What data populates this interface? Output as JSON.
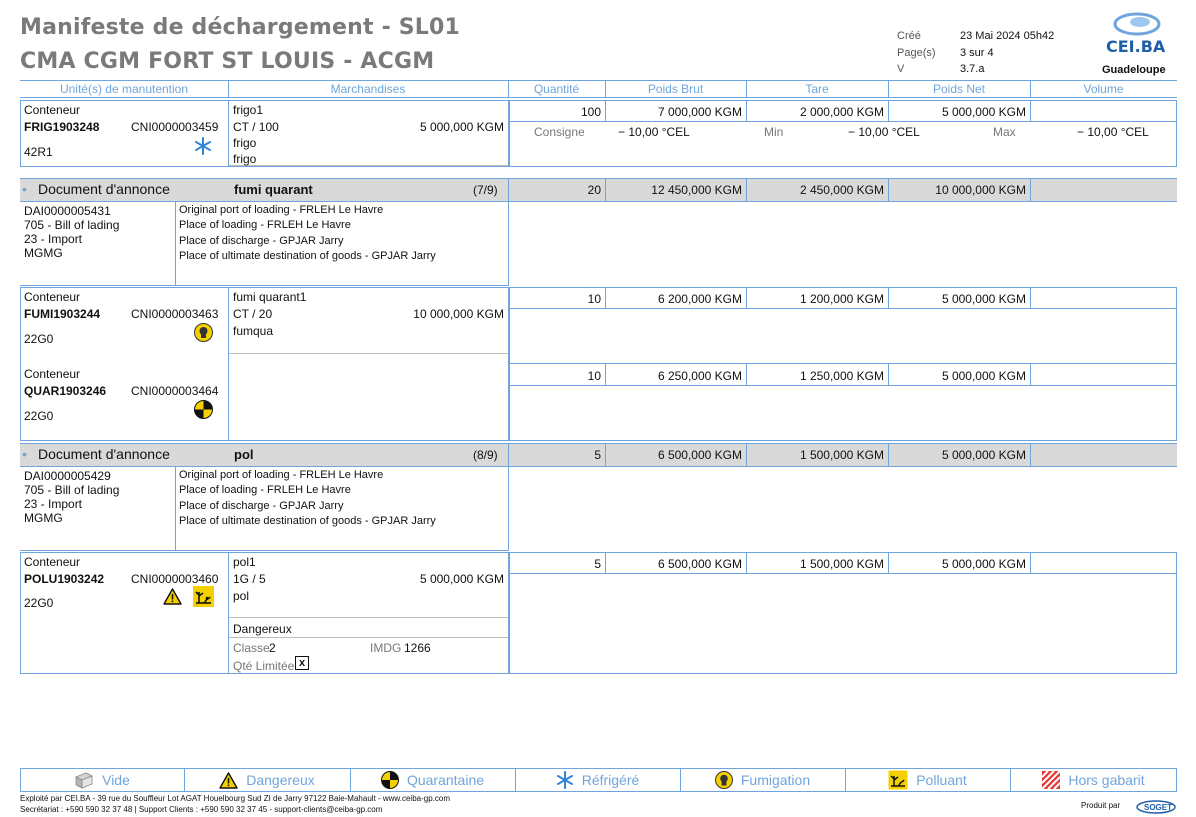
{
  "header": {
    "title": "Manifeste de déchargement - SL01",
    "vessel": "CMA CGM FORT ST LOUIS - ACGM",
    "created_label": "Créé",
    "created_value": "23 Mai 2024 05h42",
    "pages_label": "Page(s)",
    "pages_value": "3 sur 4",
    "version_label": "V",
    "version_value": "3.7.a",
    "logo_text": "CEI.BA",
    "region": "Guadeloupe"
  },
  "columns": {
    "units": "Unité(s) de manutention",
    "goods": "Marchandises",
    "qty": "Quantité",
    "gross": "Poids Brut",
    "tare": "Tare",
    "net": "Poids Net",
    "volume": "Volume"
  },
  "frig": {
    "label": "Conteneur",
    "number": "FRIG1903248",
    "cni": "CNI0000003459",
    "type": "42R1",
    "goods_title": "frigo1",
    "goods_pack": "CT /  100",
    "goods_weight": "5 000,000 KGM",
    "goods_line1": "frigo",
    "goods_line2": "frigo",
    "qty": "100",
    "gross": "7 000,000 KGM",
    "tare": "2 000,000 KGM",
    "net": "5 000,000 KGM",
    "consigne_label": "Consigne",
    "consigne_value": "−  10,00 °CEL",
    "min_label": "Min",
    "min_value": "−  10,00 °CEL",
    "max_label": "Max",
    "max_value": "−  10,00 °CEL"
  },
  "doc1": {
    "label": "Document d'annonce",
    "name": "fumi quarant",
    "count": "(7/9)",
    "qty": "20",
    "gross": "12 450,000 KGM",
    "tare": "2 450,000 KGM",
    "net": "10 000,000 KGM",
    "dai": "DAI0000005431",
    "bl": "705 - Bill of lading",
    "regime": "23 - Import",
    "code": "MGMG",
    "port_loading": "Original port of loading - FRLEH Le Havre",
    "place_loading": "Place of loading - FRLEH Le Havre",
    "place_discharge": "Place of discharge - GPJAR Jarry",
    "place_dest": "Place of ultimate destination of goods - GPJAR Jarry"
  },
  "fumi": {
    "label": "Conteneur",
    "number": "FUMI1903244",
    "cni": "CNI0000003463",
    "type": "22G0",
    "goods_title": "fumi quarant1",
    "goods_pack": "CT /  20",
    "goods_weight": "10 000,000 KGM",
    "goods_line1": "fumqua",
    "qty": "10",
    "gross": "6 200,000 KGM",
    "tare": "1 200,000 KGM",
    "net": "5 000,000 KGM"
  },
  "quar": {
    "label": "Conteneur",
    "number": "QUAR1903246",
    "cni": "CNI0000003464",
    "type": "22G0",
    "qty": "10",
    "gross": "6 250,000 KGM",
    "tare": "1 250,000 KGM",
    "net": "5 000,000 KGM"
  },
  "doc2": {
    "label": "Document d'annonce",
    "name": "pol",
    "count": "(8/9)",
    "qty": "5",
    "gross": "6 500,000 KGM",
    "tare": "1 500,000 KGM",
    "net": "5 000,000 KGM",
    "dai": "DAI0000005429",
    "bl": "705 - Bill of lading",
    "regime": "23 - Import",
    "code": "MGMG",
    "port_loading": "Original port of loading - FRLEH Le Havre",
    "place_loading": "Place of loading - FRLEH Le Havre",
    "place_discharge": "Place of discharge - GPJAR Jarry",
    "place_dest": "Place of ultimate destination of goods - GPJAR Jarry"
  },
  "polu": {
    "label": "Conteneur",
    "number": "POLU1903242",
    "cni": "CNI0000003460",
    "type": "22G0",
    "goods_title": "pol1",
    "goods_pack": "1G /  5",
    "goods_weight": "5 000,000 KGM",
    "goods_line1": "pol",
    "danger_title": "Dangereux",
    "classe_label": "Classe",
    "classe_value": "2",
    "imdg_label": "IMDG",
    "imdg_value": "1266",
    "qte_label": "Qté Limitée",
    "qte_mark": "x",
    "qty": "5",
    "gross": "6 500,000 KGM",
    "tare": "1 500,000 KGM",
    "net": "5 000,000 KGM"
  },
  "legend": {
    "vide": "Vide",
    "dangereux": "Dangereux",
    "quarantaine": "Quarantaine",
    "refrigere": "Réfrigéré",
    "fumigation": "Fumigation",
    "polluant": "Polluant",
    "hors_gabarit": "Hors gabarit"
  },
  "footer": {
    "line1": "Exploité par CEI.BA - 39 rue du Souffleur Lot AGAT Houelbourg Sud ZI de Jarry 97122 Baie-Mahault - www.ceiba-gp.com",
    "line2": "Secrétariat : +590 590 32 37 48 | Support Clients : +590 590 32 37 45 - support-clients@ceiba-gp.com",
    "produced_by": "Produit par",
    "soget_logo": "SOGET"
  },
  "colors": {
    "rule_blue": "#6fa5dc",
    "band_grey": "#d9d9d9",
    "title_grey": "#7a7a7a",
    "logo_blue": "#1f5fa8",
    "hazard_yellow": "#f5d000",
    "refrigerated_blue": "#2f86d6",
    "oversize_red": "#e53935"
  },
  "icons": [
    "snowflake-icon",
    "fumigation-icon",
    "quarantine-icon",
    "hazard-warning-icon",
    "pollutant-icon",
    "empty-container-icon",
    "oversize-icon"
  ]
}
